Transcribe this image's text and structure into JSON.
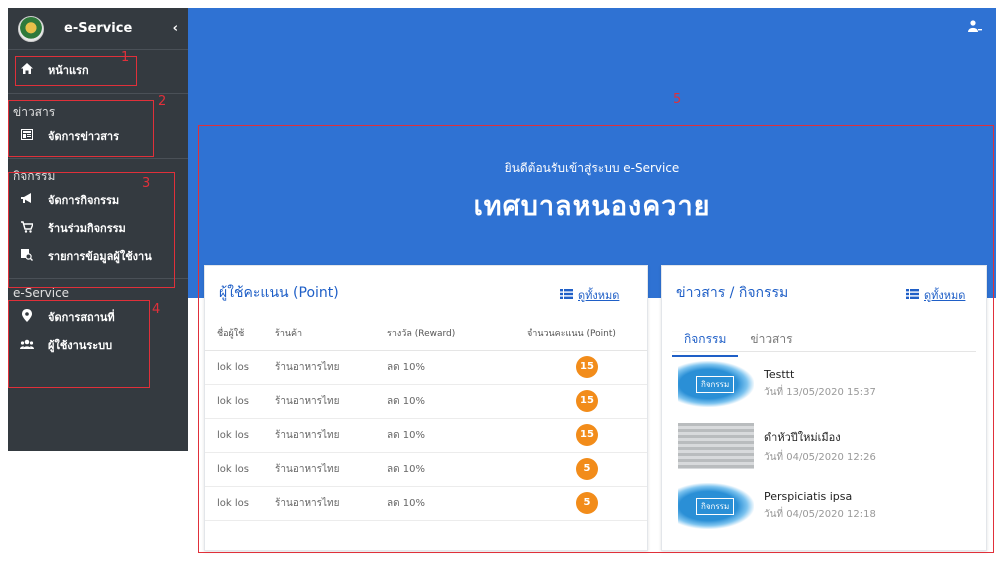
{
  "sidebar": {
    "brand": "e-Service",
    "collapse_icon": "‹",
    "home": {
      "label": "หน้าแรก",
      "icon": "home-icon"
    },
    "sections": [
      {
        "title": "ข่าวสาร",
        "items": [
          {
            "label": "จัดการข่าวสาร",
            "icon": "newspaper-icon"
          }
        ]
      },
      {
        "title": "กิจกรรม",
        "items": [
          {
            "label": "จัดการกิจกรรม",
            "icon": "megaphone-icon"
          },
          {
            "label": "ร้านร่วมกิจกรรม",
            "icon": "cart-icon"
          },
          {
            "label": "รายการข้อมูลผู้ใช้งาน",
            "icon": "search-list-icon"
          }
        ]
      },
      {
        "title": "e-Service",
        "items": [
          {
            "label": "จัดการสถานที่",
            "icon": "map-marker-icon"
          },
          {
            "label": "ผู้ใช้งานระบบ",
            "icon": "users-icon"
          }
        ]
      }
    ]
  },
  "annotations": [
    "1",
    "2",
    "3",
    "4",
    "5"
  ],
  "banner": {
    "welcome": "ยินดีต้อนรับเข้าสู่ระบบ e-Service",
    "title": "เทศบาลหนองควาย"
  },
  "points_card": {
    "title": "ผู้ใช้คะแนน (Point)",
    "view_all": "ดูทั้งหมด",
    "columns": [
      "ชื่อผู้ใช้",
      "ร้านค้า",
      "รางวัล (Reward)",
      "จำนวนคะแนน (Point)"
    ],
    "rows": [
      {
        "name": "lok los",
        "shop": "ร้านอาหารไทย",
        "reward": "ลด 10%",
        "points": "15"
      },
      {
        "name": "lok los",
        "shop": "ร้านอาหารไทย",
        "reward": "ลด 10%",
        "points": "15"
      },
      {
        "name": "lok los",
        "shop": "ร้านอาหารไทย",
        "reward": "ลด 10%",
        "points": "15"
      },
      {
        "name": "lok los",
        "shop": "ร้านอาหารไทย",
        "reward": "ลด 10%",
        "points": "5"
      },
      {
        "name": "lok los",
        "shop": "ร้านอาหารไทย",
        "reward": "ลด 10%",
        "points": "5"
      }
    ]
  },
  "news_card": {
    "title": "ข่าวสาร / กิจกรรม",
    "view_all": "ดูทั้งหมด",
    "tabs": [
      "กิจกรรม",
      "ข่าวสาร"
    ],
    "thumb_label": "กิจกรรม",
    "items": [
      {
        "title": "Testtt",
        "date": "วันที่ 13/05/2020 15:37"
      },
      {
        "title": "ดำหัวปีใหม่เมือง",
        "date": "วันที่ 04/05/2020 12:26"
      },
      {
        "title": "Perspiciatis ipsa",
        "date": "วันที่ 04/05/2020 12:18"
      }
    ]
  },
  "colors": {
    "banner": "#2f72d3",
    "sidebar": "#343a40",
    "accent": "#1f5fc7",
    "badge": "#f28c1a",
    "annotation": "#e0303a"
  }
}
